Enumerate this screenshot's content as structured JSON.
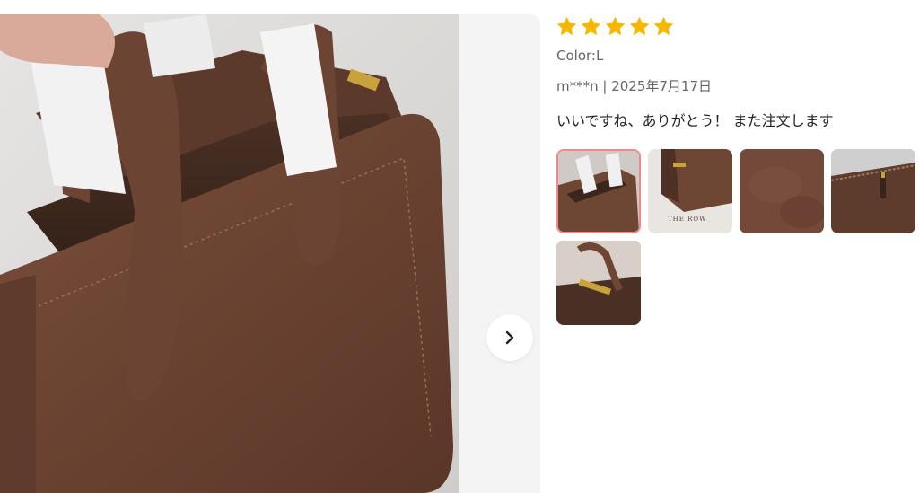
{
  "review": {
    "rating": 5,
    "star_color": "#f5b800",
    "color_label": "Color:L",
    "author_date": "m***n | 2025年7月17日",
    "text": "いいですね、ありがとう！ また注文します"
  },
  "gallery": {
    "next_icon": "chevron-right-icon",
    "selected_index": 0,
    "thumbnails": [
      {
        "name": "thumb-1",
        "brand_text": ""
      },
      {
        "name": "thumb-2",
        "brand_text": "THE ROW"
      },
      {
        "name": "thumb-3",
        "brand_text": ""
      },
      {
        "name": "thumb-4",
        "brand_text": ""
      },
      {
        "name": "thumb-5",
        "brand_text": ""
      }
    ]
  },
  "colors": {
    "suede_brown": "#6e4634",
    "background_gray": "#f4f4f4",
    "selected_border": "#f08a8a"
  }
}
